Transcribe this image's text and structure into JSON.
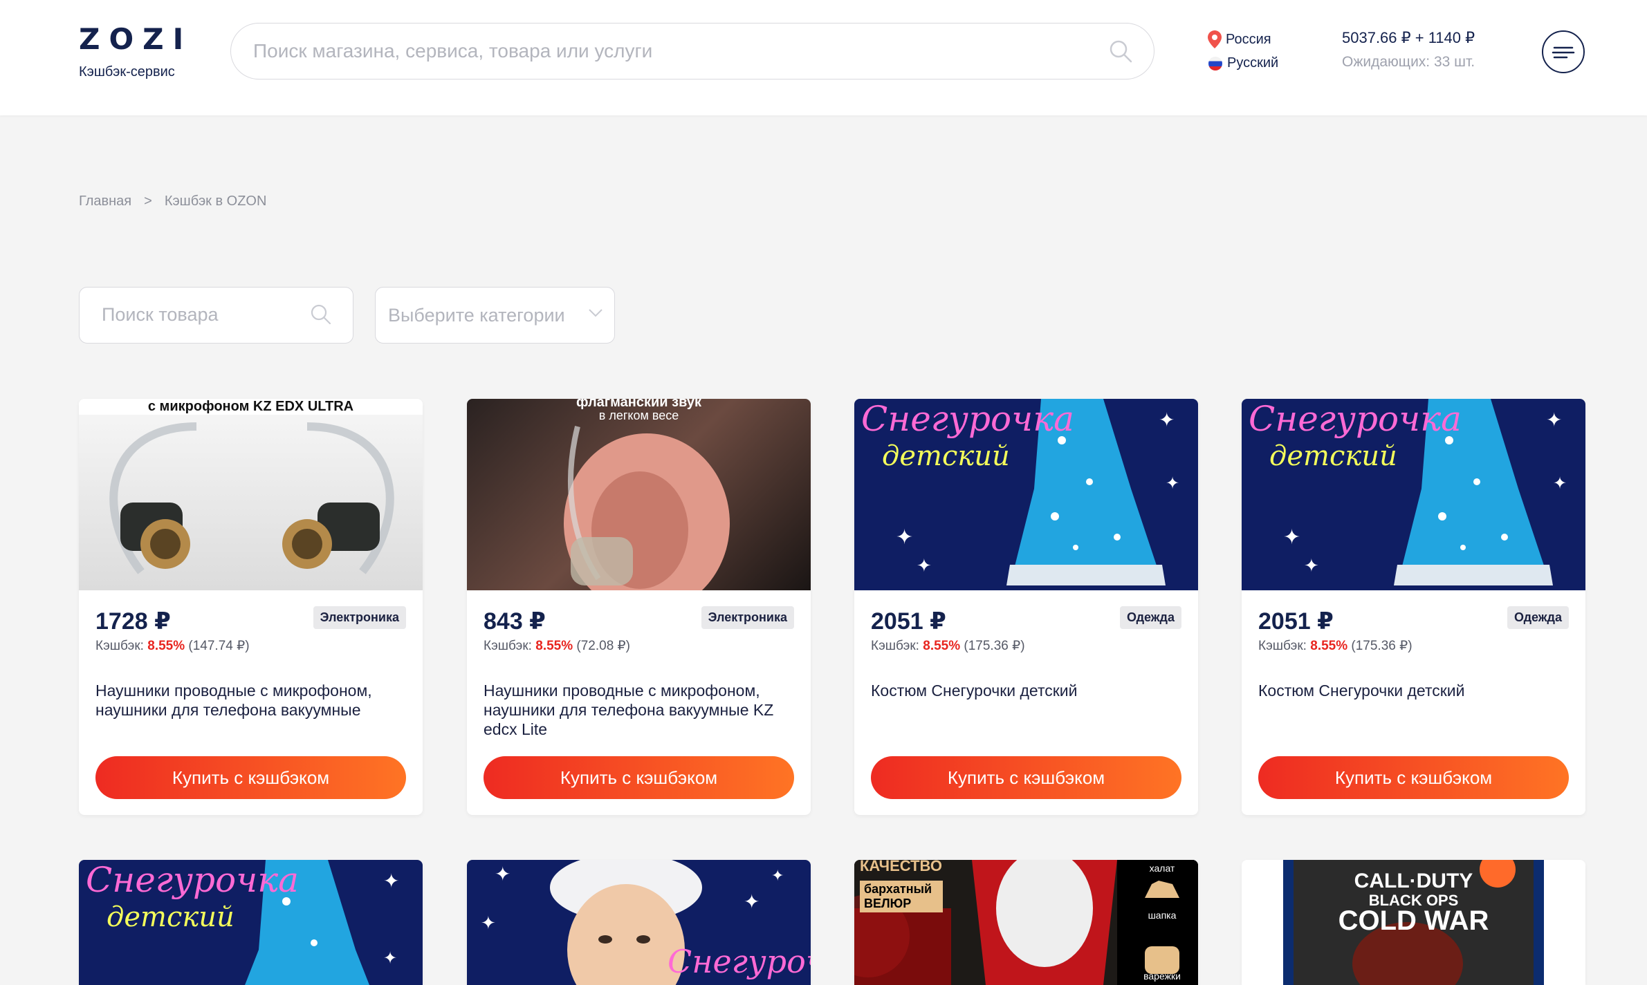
{
  "header": {
    "logo": "ZOZI",
    "logo_sub": "Кэшбэк-сервис",
    "search_placeholder": "Поиск магазина, сервиса, товара или услуги",
    "region": "Россия",
    "language": "Русский",
    "balance": "5037.66 ₽ + 1140 ₽",
    "pending": "Ожидающих: 33 шт."
  },
  "breadcrumb": {
    "home": "Главная",
    "separator": ">",
    "current": "Кэшбэк в OZON"
  },
  "filters": {
    "search_placeholder": "Поиск товара",
    "category_placeholder": "Выберите категории"
  },
  "colors": {
    "brand": "#14224d",
    "accent_from": "#ee2b22",
    "accent_to": "#ff7424",
    "cashback_pct": "#e8251f"
  },
  "cashback_label": "Кэшбэк:",
  "buy_label": "Купить с кэшбэком",
  "products": [
    {
      "image_caption": "с микрофоном KZ EDX ULTRA",
      "price": "1728 ₽",
      "category": "Электроника",
      "cashback_pct": "8.55%",
      "cashback_amount": "(147.74 ₽)",
      "title": "Наушники проводные с микрофоном, наушники для телефона вакуумные"
    },
    {
      "image_caption": "флагманский звук",
      "image_caption2": "в легком весе",
      "price": "843 ₽",
      "category": "Электроника",
      "cashback_pct": "8.55%",
      "cashback_amount": "(72.08 ₽)",
      "title": "Наушники проводные с микрофоном, наушники для телефона вакуумные KZ edcx Lite"
    },
    {
      "image_caption": "Снегурочка",
      "image_caption2": "детский",
      "price": "2051 ₽",
      "category": "Одежда",
      "cashback_pct": "8.55%",
      "cashback_amount": "(175.36 ₽)",
      "title": "Костюм Снегурочки детский"
    },
    {
      "image_caption": "Снегурочка",
      "image_caption2": "детский",
      "price": "2051 ₽",
      "category": "Одежда",
      "cashback_pct": "8.55%",
      "cashback_amount": "(175.36 ₽)",
      "title": "Костюм Снегурочки детский"
    }
  ],
  "second_row": [
    {
      "caption": "Снегурочка",
      "caption2": "детский"
    },
    {
      "caption": "Снегурочки"
    },
    {
      "caption": "КАЧЕСТВО",
      "caption2": "бархатный ВЕЛЮР",
      "caption3": "халат",
      "caption4": "шапка",
      "caption5": "варежки"
    },
    {
      "caption": "CALL·DUTY",
      "caption2": "BLACK OPS",
      "caption3": "COLD WAR"
    }
  ]
}
